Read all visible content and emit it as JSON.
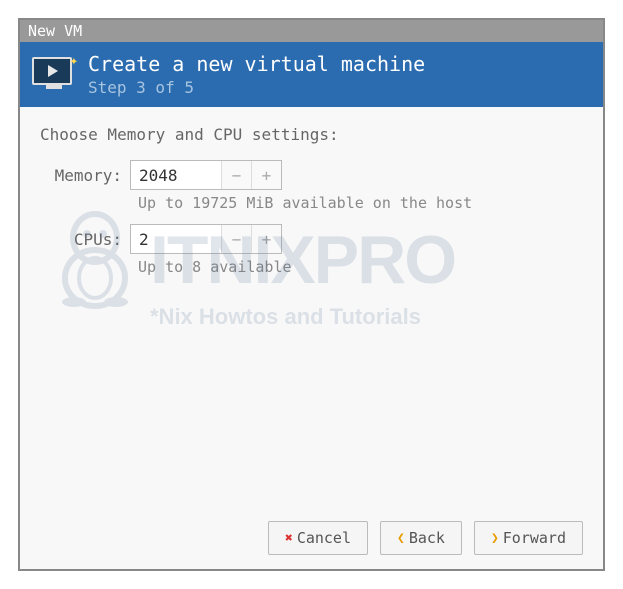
{
  "window": {
    "title": "New VM"
  },
  "header": {
    "title": "Create a new virtual machine",
    "step": "Step 3 of 5"
  },
  "content": {
    "section_label": "Choose Memory and CPU settings:",
    "memory": {
      "label": "Memory:",
      "value": "2048",
      "hint": "Up to 19725 MiB available on the host"
    },
    "cpus": {
      "label": "CPUs:",
      "value": "2",
      "hint": "Up to 8 available"
    }
  },
  "footer": {
    "cancel": "Cancel",
    "back": "Back",
    "forward": "Forward"
  },
  "watermark": {
    "brand": "ITNIXPRO",
    "tagline": "*Nix Howtos and Tutorials"
  }
}
